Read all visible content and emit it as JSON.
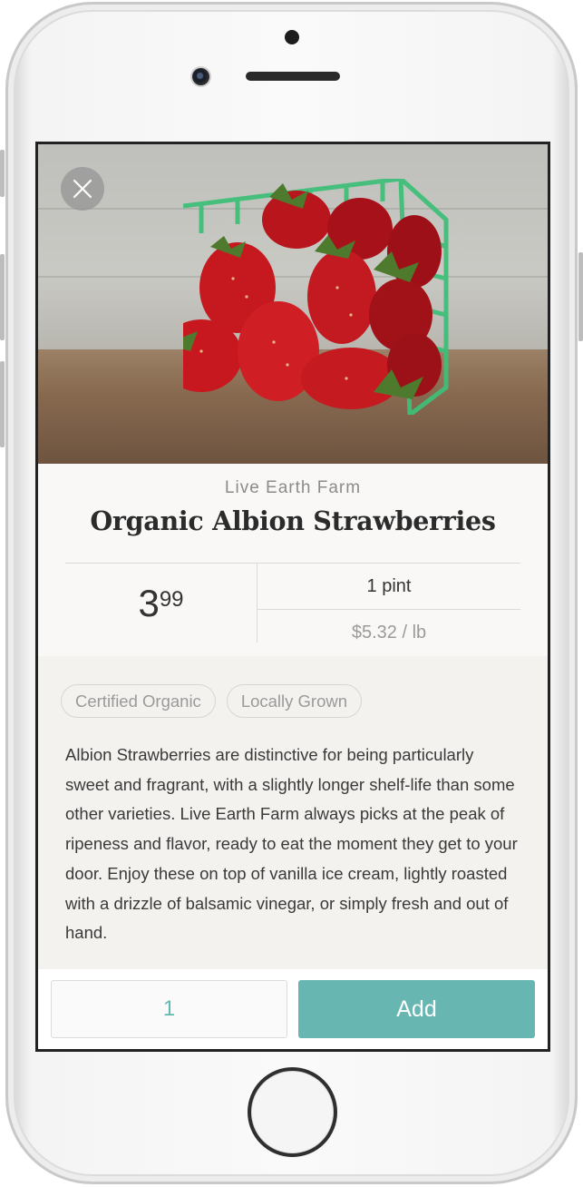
{
  "product": {
    "farm": "Live Earth Farm",
    "title": "Organic Albion Strawberries",
    "price_dollars": "3",
    "price_cents": "99",
    "unit": "1 pint",
    "price_per_lb": "$5.32 / lb",
    "tags": [
      "Certified Organic",
      "Locally Grown"
    ],
    "description": "Albion Strawberries are distinctive for being particularly sweet and fragrant, with a slightly longer shelf-life than some other varieties.  Live Earth Farm always picks at the peak of ripeness and flavor, ready to eat the moment they get to your door. Enjoy these on top of vanilla ice cream, lightly roasted with a drizzle of balsamic vinegar, or simply fresh and out of hand.",
    "image": "strawberries-in-green-basket"
  },
  "cart": {
    "quantity": "1",
    "add_label": "Add"
  },
  "icons": {
    "close": "close-icon"
  },
  "colors": {
    "accent": "#67b6b1",
    "title": "#2b2b2b",
    "muted": "#9a9a9a"
  }
}
